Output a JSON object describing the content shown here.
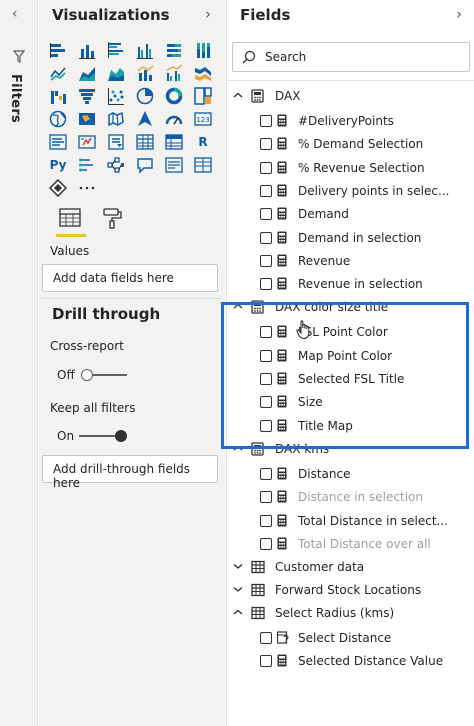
{
  "filters": {
    "label": "Filters",
    "collapse_icon": "chevron-left-icon",
    "icon": "filter-funnel-icon"
  },
  "visualizations": {
    "title": "Visualizations",
    "expand_icon": "chevron-right-icon",
    "icons": [
      "stacked-bar-chart-icon",
      "stacked-column-chart-icon",
      "clustered-bar-chart-icon",
      "clustered-column-chart-icon",
      "100-stacked-bar-chart-icon",
      "100-stacked-column-chart-icon",
      "line-chart-icon",
      "area-chart-icon",
      "stacked-area-chart-icon",
      "line-and-column-chart-icon",
      "line-and-clustered-column-chart-icon",
      "ribbon-chart-icon",
      "waterfall-chart-icon",
      "funnel-chart-icon",
      "scatter-chart-icon",
      "pie-chart-icon",
      "donut-chart-icon",
      "treemap-icon",
      "map-icon",
      "filled-map-icon",
      "shape-map-icon",
      "arcgis-map-icon",
      "gauge-icon",
      "card-icon",
      "multi-row-card-icon",
      "kpi-icon",
      "slicer-icon",
      "table-icon",
      "matrix-icon",
      "r-visual-icon",
      "python-visual-icon",
      "key-influencers-icon",
      "decomposition-tree-icon",
      "qa-icon",
      "smart-narrative-icon",
      "paginated-report-icon",
      "power-apps-icon",
      "more-visuals-icon"
    ],
    "tabs": {
      "fields_icon": "fields-well-icon",
      "format_icon": "paint-roller-icon"
    },
    "values_label": "Values",
    "values_placeholder": "Add data fields here",
    "drill_through": {
      "title": "Drill through",
      "cross_report_label": "Cross-report",
      "cross_report_state": "Off",
      "keep_filters_label": "Keep all filters",
      "keep_filters_state": "On",
      "drop_placeholder": "Add drill-through fields here"
    }
  },
  "fields": {
    "title": "Fields",
    "expand_icon": "chevron-right-icon",
    "search": {
      "placeholder": "Search",
      "value": ""
    },
    "tables": [
      {
        "name": "DAX",
        "expanded": true,
        "fields": [
          {
            "name": "#DeliveryPoints",
            "dim": false
          },
          {
            "name": "% Demand Selection",
            "dim": false
          },
          {
            "name": "% Revenue Selection",
            "dim": false
          },
          {
            "name": "Delivery points in selec...",
            "dim": false
          },
          {
            "name": "Demand",
            "dim": false
          },
          {
            "name": "Demand in selection",
            "dim": false
          },
          {
            "name": "Revenue",
            "dim": false
          },
          {
            "name": "Revenue in selection",
            "dim": false
          }
        ]
      },
      {
        "name": "DAX color size title",
        "expanded": true,
        "more": "···",
        "fields": [
          {
            "name": "FSL Point Color",
            "dim": false
          },
          {
            "name": "Map Point Color",
            "dim": false
          },
          {
            "name": "Selected FSL Title",
            "dim": false
          },
          {
            "name": "Size",
            "dim": false
          },
          {
            "name": "Title Map",
            "dim": false
          }
        ]
      },
      {
        "name": "DAX kms",
        "expanded": true,
        "fields": [
          {
            "name": "Distance",
            "dim": false
          },
          {
            "name": "Distance in selection",
            "dim": true
          },
          {
            "name": "Total Distance in select...",
            "dim": false
          },
          {
            "name": "Total Distance over all",
            "dim": true
          }
        ]
      },
      {
        "name": "Customer data",
        "expanded": false,
        "fields": []
      },
      {
        "name": "Forward Stock Locations",
        "expanded": false,
        "fields": []
      },
      {
        "name": "Select Radius (kms)",
        "expanded": true,
        "fields": [
          {
            "name": "Select Distance",
            "dim": false,
            "parameter": true
          },
          {
            "name": "Selected Distance Value",
            "dim": false
          }
        ]
      }
    ]
  },
  "colors": {
    "accent_yellow": "#f2c811",
    "highlight_blue": "#1a6fc9",
    "icon_blue": "#0c5ea8",
    "icon_teal": "#1aa3a3"
  }
}
